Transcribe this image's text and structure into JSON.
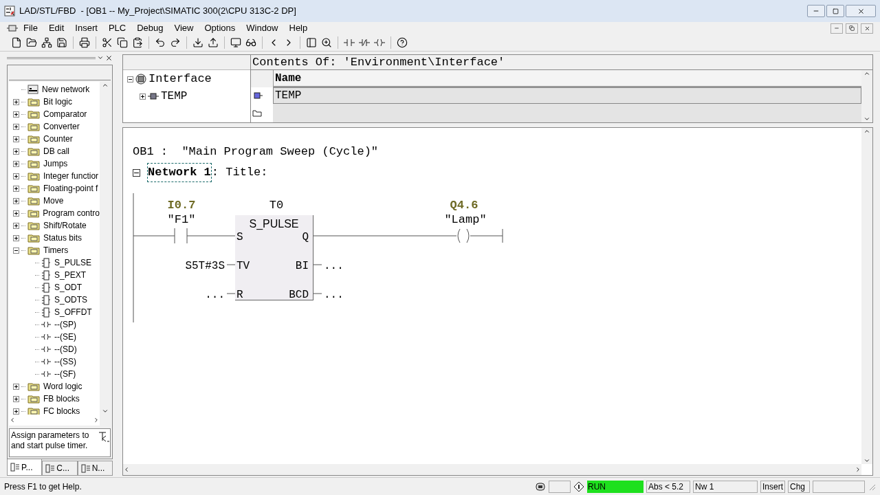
{
  "window": {
    "title": "LAD/STL/FBD  - [OB1 -- My_Project\\SIMATIC 300(2\\CPU 313C-2 DP]"
  },
  "menu": [
    "File",
    "Edit",
    "Insert",
    "PLC",
    "Debug",
    "View",
    "Options",
    "Window",
    "Help"
  ],
  "catalog": {
    "items": [
      {
        "kind": "network",
        "label": "New network"
      },
      {
        "kind": "folder",
        "label": "Bit logic",
        "expanded": false
      },
      {
        "kind": "folder",
        "label": "Comparator",
        "expanded": false
      },
      {
        "kind": "folder",
        "label": "Converter",
        "expanded": false
      },
      {
        "kind": "folder",
        "label": "Counter",
        "expanded": false
      },
      {
        "kind": "folder",
        "label": "DB call",
        "expanded": false
      },
      {
        "kind": "folder",
        "label": "Jumps",
        "expanded": false
      },
      {
        "kind": "folder",
        "label": "Integer functior",
        "expanded": false
      },
      {
        "kind": "folder",
        "label": "Floating-point f",
        "expanded": false
      },
      {
        "kind": "folder",
        "label": "Move",
        "expanded": false
      },
      {
        "kind": "folder",
        "label": "Program contro",
        "expanded": false
      },
      {
        "kind": "folder",
        "label": "Shift/Rotate",
        "expanded": false
      },
      {
        "kind": "folder",
        "label": "Status bits",
        "expanded": false
      },
      {
        "kind": "folder",
        "label": "Timers",
        "expanded": true,
        "children": [
          {
            "kind": "block",
            "label": "S_PULSE"
          },
          {
            "kind": "block",
            "label": "S_PEXT"
          },
          {
            "kind": "block",
            "label": "S_ODT"
          },
          {
            "kind": "block",
            "label": "S_ODTS"
          },
          {
            "kind": "block",
            "label": "S_OFFDT"
          },
          {
            "kind": "coil",
            "label": "--(SP)"
          },
          {
            "kind": "coil",
            "label": "--(SE)"
          },
          {
            "kind": "coil",
            "label": "--(SD)"
          },
          {
            "kind": "coil",
            "label": "--(SS)"
          },
          {
            "kind": "coil",
            "label": "--(SF)"
          }
        ]
      },
      {
        "kind": "folder",
        "label": "Word logic",
        "expanded": false
      },
      {
        "kind": "folder",
        "label": "FB blocks",
        "expanded": false
      },
      {
        "kind": "folder",
        "label": "FC blocks",
        "expanded": false
      }
    ],
    "description": "Assign parameters to and start pulse timer.",
    "tabs": [
      {
        "label": "P...",
        "selected": true
      },
      {
        "label": "C...",
        "selected": false
      },
      {
        "label": "N...",
        "selected": false
      }
    ]
  },
  "interface": {
    "tree": {
      "label": "Interface",
      "expanded": true,
      "children": [
        {
          "label": "TEMP",
          "expanded": false
        }
      ]
    },
    "contents_title": "Contents Of: 'Environment\\Interface'",
    "column": "Name",
    "rows": [
      "TEMP"
    ]
  },
  "editor": {
    "block_title": "OB1 :  \"Main Program Sweep (Cycle)\"",
    "network": "Network 1",
    "network_focused": true,
    "network_title": ": Title:",
    "contact": {
      "address": "I0.7",
      "symbol": "\"F1\""
    },
    "timer": {
      "address": "T0",
      "type": "S_PULSE",
      "pins_in": [
        "S",
        "TV",
        "R"
      ],
      "pins_out": [
        "Q",
        "BI",
        "BCD"
      ],
      "params_in": [
        "S5T#3S",
        "..."
      ],
      "params_out": [
        "...",
        "..."
      ]
    },
    "coil": {
      "address": "Q4.6",
      "symbol": "\"Lamp\""
    }
  },
  "status_bar": {
    "help": "Press F1 to get Help.",
    "mode": "RUN",
    "running": true,
    "position": "Abs < 5.2",
    "network": "Nw 1",
    "insert": "Insert",
    "changed": "Chg"
  }
}
